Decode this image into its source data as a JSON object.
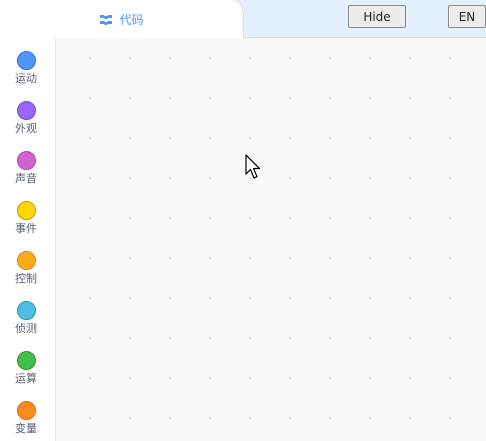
{
  "header": {
    "code_tab_label": "代码",
    "hide_button_label": "Hide",
    "language_button_label": "EN"
  },
  "categories": [
    {
      "label": "运动",
      "color": "#4c97ff",
      "border": "#3373cc"
    },
    {
      "label": "外观",
      "color": "#9966ff",
      "border": "#774dcb"
    },
    {
      "label": "声音",
      "color": "#cf63cf",
      "border": "#bd42bd"
    },
    {
      "label": "事件",
      "color": "#ffd500",
      "border": "#cc9900"
    },
    {
      "label": "控制",
      "color": "#ffab19",
      "border": "#cf8b17"
    },
    {
      "label": "侦测",
      "color": "#4cbfe6",
      "border": "#2e8eb8"
    },
    {
      "label": "运算",
      "color": "#40bf4a",
      "border": "#389438"
    },
    {
      "label": "变量",
      "color": "#ff8c1a",
      "border": "#db6e00"
    }
  ],
  "icons": {
    "code_tab_icon": "code-blocks-icon",
    "cursor": "mouse-pointer-icon"
  }
}
